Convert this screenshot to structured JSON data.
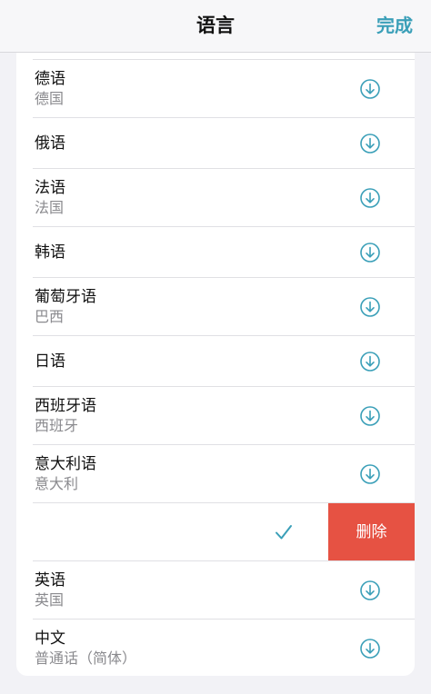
{
  "nav": {
    "title": "语言",
    "done_label": "完成"
  },
  "languages_top": [
    {
      "name": "德语",
      "region": "德国"
    },
    {
      "name": "俄语",
      "region": ""
    },
    {
      "name": "法语",
      "region": "法国"
    },
    {
      "name": "韩语",
      "region": ""
    },
    {
      "name": "葡萄牙语",
      "region": "巴西"
    },
    {
      "name": "日语",
      "region": ""
    },
    {
      "name": "西班牙语",
      "region": "西班牙"
    },
    {
      "name": "意大利语",
      "region": "意大利"
    }
  ],
  "swiped_row": {
    "delete_label": "删除"
  },
  "languages_bottom": [
    {
      "name": "英语",
      "region": "英国"
    },
    {
      "name": "中文",
      "region": "普通话（简体）"
    }
  ],
  "colors": {
    "accent": "#3a9fb8",
    "delete": "#e65243"
  },
  "icons": {
    "download": "download-circle-icon",
    "selected": "checkmark-icon"
  }
}
